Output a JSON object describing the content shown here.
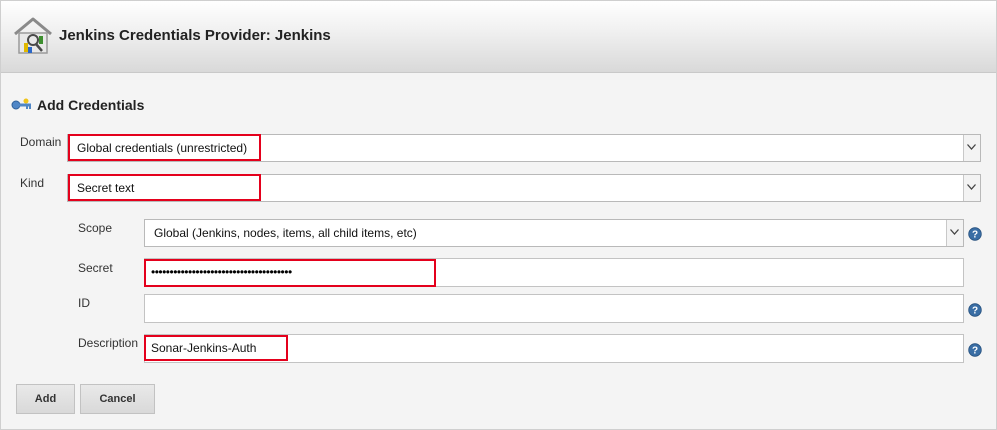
{
  "header": {
    "title": "Jenkins Credentials Provider: Jenkins"
  },
  "section": {
    "title": "Add Credentials"
  },
  "form": {
    "domain": {
      "label": "Domain",
      "value": "Global credentials (unrestricted)"
    },
    "kind": {
      "label": "Kind",
      "value": "Secret text"
    },
    "scope": {
      "label": "Scope",
      "value": "Global (Jenkins, nodes, items, all child items, etc)"
    },
    "secret": {
      "label": "Secret",
      "value": "••••••••••••••••••••••••••••••••••••••"
    },
    "id": {
      "label": "ID",
      "value": ""
    },
    "description": {
      "label": "Description",
      "value": "Sonar-Jenkins-Auth"
    }
  },
  "buttons": {
    "add": "Add",
    "cancel": "Cancel"
  },
  "colors": {
    "highlight": "#e4001c",
    "help_icon": "#3a6ea5"
  },
  "icons": {
    "header": "credentials-house-key-icon",
    "section": "key-icon",
    "help": "help-question-icon",
    "dropdown": "chevron-down-icon"
  }
}
